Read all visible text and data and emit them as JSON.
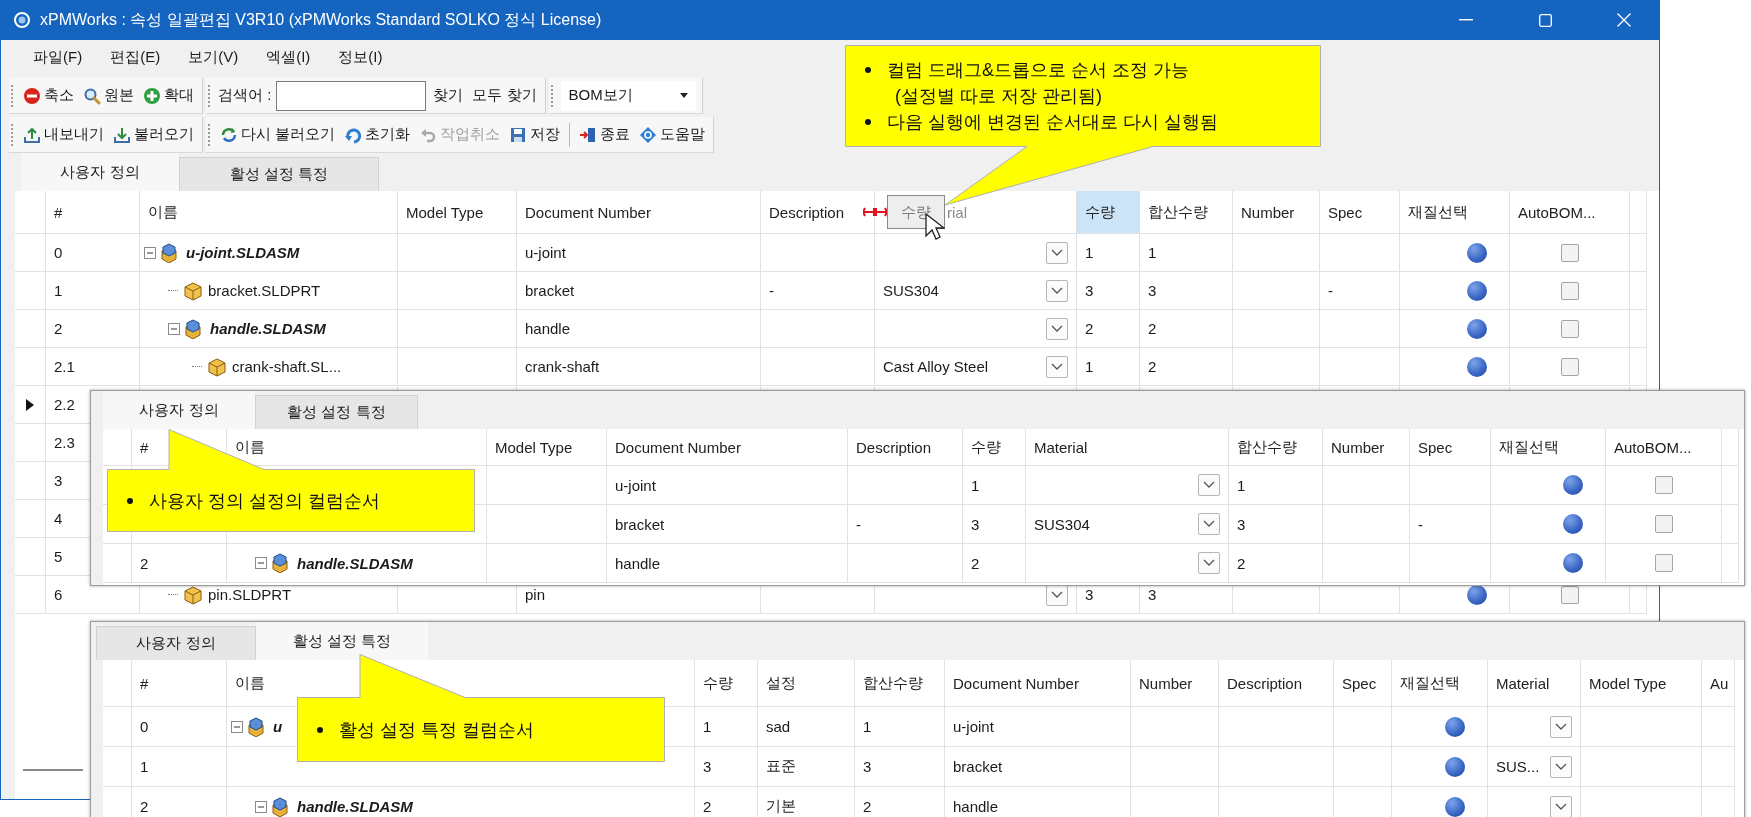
{
  "window": {
    "title": "xPMWorks : 속성 일괄편집 V3R10 (xPMWorks Standard SOLKO 정식 License)"
  },
  "menu": [
    "파일(F)",
    "편집(E)",
    "보기(V)",
    "엑셀(I)",
    "정보(I)"
  ],
  "toolbar_1": {
    "view_buttons": [
      {
        "label": "축소",
        "kind": "minus"
      },
      {
        "label": "원본",
        "kind": "magnifier"
      },
      {
        "label": "확대",
        "kind": "plus"
      }
    ],
    "search": {
      "label": "검색어 :"
    },
    "find_buttons": [
      "찾기",
      "모두 찾기"
    ],
    "view_select": {
      "value": "BOM보기"
    }
  },
  "toolbar_2": {
    "groups": [
      {
        "sections": [
          [
            {
              "label": "내보내기",
              "kind": "export",
              "disabled": false
            },
            {
              "label": "불러오기",
              "kind": "import",
              "disabled": false
            }
          ]
        ]
      },
      {
        "sections": [
          [
            {
              "label": "다시 불러오기",
              "kind": "reload",
              "disabled": false
            },
            {
              "label": "초기화",
              "kind": "reset",
              "disabled": false
            },
            {
              "label": "작업취소",
              "kind": "undo",
              "disabled": true
            },
            {
              "label": "저장",
              "kind": "save",
              "disabled": false
            }
          ],
          [
            {
              "label": "종료",
              "kind": "exit",
              "disabled": false
            },
            {
              "label": "도움말",
              "kind": "help",
              "disabled": false
            }
          ]
        ]
      }
    ]
  },
  "main_grid": {
    "tabs": [
      {
        "label": "사용자 정의",
        "selected": true
      },
      {
        "label": "활성 설정 특정",
        "selected": false
      }
    ],
    "columns": [
      {
        "label": "#",
        "kind": "number",
        "highlighted": false,
        "ghost_over": false
      },
      {
        "label": "이름",
        "kind": "name",
        "highlighted": false,
        "ghost_over": false
      },
      {
        "label": "Model Type",
        "kind": "modeltype",
        "highlighted": false,
        "ghost_over": false
      },
      {
        "label": "Document Number",
        "kind": "docnumber",
        "highlighted": false,
        "ghost_over": false
      },
      {
        "label": "Description",
        "kind": "description",
        "highlighted": false,
        "ghost_over": false
      },
      {
        "label": "rial",
        "kind": "material",
        "highlighted": false,
        "ghost_over": true
      },
      {
        "label": "수량",
        "kind": "qty",
        "highlighted": true,
        "ghost_over": false
      },
      {
        "label": "합산수량",
        "kind": "total",
        "highlighted": false,
        "ghost_over": false
      },
      {
        "label": "Number",
        "kind": "partnumber",
        "highlighted": false,
        "ghost_over": false
      },
      {
        "label": "Spec",
        "kind": "spec",
        "highlighted": false,
        "ghost_over": false
      },
      {
        "label": "재질선택",
        "kind": "swatch",
        "highlighted": false,
        "ghost_over": false
      },
      {
        "label": "AutoBOM...",
        "kind": "checkbox",
        "highlighted": false,
        "ghost_over": false
      }
    ],
    "drag_ghost": {
      "label": "수량"
    },
    "rows": [
      {
        "number": "0",
        "name": "u-joint.SLDASM",
        "kind": "assembly",
        "expanded": true,
        "docnumber": "u-joint",
        "qty": "1",
        "total": "1",
        "autobom_checked": false,
        "selected": false,
        "children": [
          {
            "number": "1",
            "name": "bracket.SLDPRT",
            "kind": "part",
            "docnumber": "bracket",
            "description": "-",
            "material": "SUS304",
            "qty": "3",
            "total": "3",
            "spec": "-",
            "autobom_checked": false,
            "selected": false
          },
          {
            "number": "2",
            "name": "handle.SLDASM",
            "kind": "assembly",
            "expanded": true,
            "docnumber": "handle",
            "qty": "2",
            "total": "2",
            "autobom_checked": false,
            "selected": false,
            "children": [
              {
                "number": "2.1",
                "name": "crank-shaft.SL...",
                "kind": "part",
                "docnumber": "crank-shaft",
                "material": "Cast Alloy Steel",
                "qty": "1",
                "total": "2",
                "autobom_checked": false,
                "selected": false
              },
              {
                "number": "2.2",
                "selected": true
              },
              {
                "number": "2.3",
                "selected": false
              }
            ]
          },
          {
            "number": "3",
            "selected": false
          },
          {
            "number": "4",
            "selected": false
          },
          {
            "number": "5",
            "selected": false
          },
          {
            "number": "6",
            "name": "pin.SLDPRT",
            "kind": "part",
            "docnumber": "pin",
            "qty": "3",
            "total": "3",
            "autobom_checked": false,
            "selected": false
          }
        ]
      }
    ]
  },
  "overlay_grids": [
    {
      "tabs": [
        {
          "label": "사용자 정의",
          "selected": true
        },
        {
          "label": "활성 설정 특정",
          "selected": false
        }
      ],
      "columns": [
        {
          "label": "#",
          "kind": "number",
          "highlighted": false
        },
        {
          "label": "이름",
          "kind": "name",
          "highlighted": false
        },
        {
          "label": "Model Type",
          "kind": "modeltype",
          "highlighted": false
        },
        {
          "label": "Document Number",
          "kind": "docnumber",
          "highlighted": false
        },
        {
          "label": "Description",
          "kind": "description",
          "highlighted": false
        },
        {
          "label": "수량",
          "kind": "qty",
          "highlighted": false
        },
        {
          "label": "Material",
          "kind": "material",
          "highlighted": false
        },
        {
          "label": "합산수량",
          "kind": "total",
          "highlighted": false
        },
        {
          "label": "Number",
          "kind": "partnumber",
          "highlighted": false
        },
        {
          "label": "Spec",
          "kind": "spec",
          "highlighted": false
        },
        {
          "label": "재질선택",
          "kind": "swatch",
          "highlighted": false
        },
        {
          "label": "AutoBOM...",
          "kind": "checkbox",
          "highlighted": false
        }
      ],
      "rows": [
        {
          "docnumber": "u-joint",
          "qty": "1",
          "total": "1",
          "autobom_checked": false,
          "children": [
            {
              "docnumber": "bracket",
              "description": "-",
              "qty": "3",
              "material": "SUS304",
              "total": "3",
              "spec": "-",
              "autobom_checked": false
            },
            {
              "number": "2",
              "name": "handle.SLDASM",
              "kind": "assembly",
              "expanded": true,
              "docnumber": "handle",
              "qty": "2",
              "total": "2",
              "autobom_checked": false
            }
          ]
        }
      ]
    },
    {
      "tabs": [
        {
          "label": "사용자 정의",
          "selected": false
        },
        {
          "label": "활성 설정 특정",
          "selected": true
        }
      ],
      "columns": [
        {
          "label": "#",
          "kind": "number",
          "highlighted": false
        },
        {
          "label": "이름",
          "kind": "name",
          "highlighted": false
        },
        {
          "label": "수량",
          "kind": "qty",
          "highlighted": false
        },
        {
          "label": "설정",
          "kind": "config",
          "highlighted": false
        },
        {
          "label": "합산수량",
          "kind": "total",
          "highlighted": false
        },
        {
          "label": "Document Number",
          "kind": "docnumber",
          "highlighted": false
        },
        {
          "label": "Number",
          "kind": "partnumber",
          "highlighted": false
        },
        {
          "label": "Description",
          "kind": "description",
          "highlighted": false
        },
        {
          "label": "Spec",
          "kind": "spec",
          "highlighted": false
        },
        {
          "label": "재질선택",
          "kind": "swatch",
          "highlighted": false
        },
        {
          "label": "Material",
          "kind": "material",
          "highlighted": false
        },
        {
          "label": "Model Type",
          "kind": "modeltype",
          "highlighted": false
        },
        {
          "label": "Au",
          "kind": "extra",
          "highlighted": false
        }
      ],
      "rows": [
        {
          "number": "0",
          "name": "u",
          "kind": "assembly",
          "expanded": true,
          "qty": "1",
          "config": "sad",
          "total": "1",
          "docnumber": "u-joint",
          "children": [
            {
              "number": "1",
              "qty": "3",
              "config": "표준",
              "total": "3",
              "docnumber": "bracket",
              "material": "SUS..."
            },
            {
              "number": "2",
              "name": "handle.SLDASM",
              "kind": "assembly",
              "expanded": true,
              "qty": "2",
              "config": "기본",
              "total": "2",
              "docnumber": "handle"
            }
          ]
        }
      ]
    }
  ],
  "callouts": [
    {
      "items": [
        {
          "text": "컬럼 드래그&드롭으로 순서 조정 가능",
          "note": "(설정별 따로 저장 관리됨)"
        },
        {
          "text": "다음 실행에 변경된 순서대로 다시 실행됨"
        }
      ]
    },
    {
      "items": [
        {
          "text": "사용자 정의 설정의 컬럼순서"
        }
      ]
    },
    {
      "items": [
        {
          "text": "활성 설정 특정 컬럼순서"
        }
      ]
    }
  ]
}
